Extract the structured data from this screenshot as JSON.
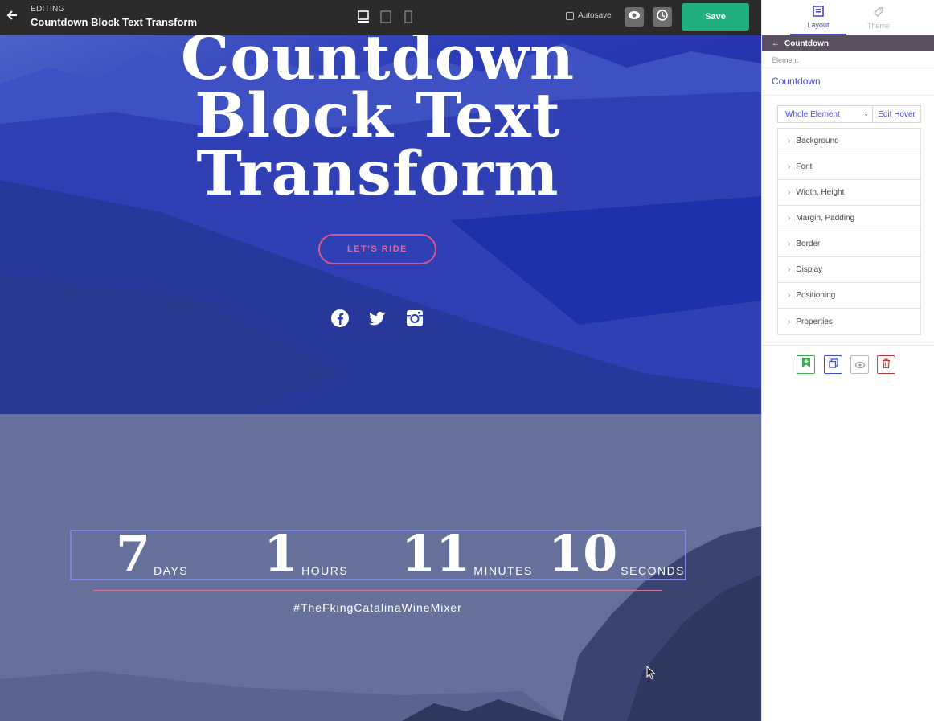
{
  "topbar": {
    "editing_label": "EDITING",
    "title": "Countdown Block Text Transform",
    "autosave_label": "Autosave",
    "save_label": "Save"
  },
  "hero": {
    "title_lines": [
      "Countdown",
      "Block Text",
      "Transform"
    ],
    "button_label": "LET'S RIDE",
    "social": [
      "facebook-icon",
      "twitter-icon",
      "instagram-icon"
    ]
  },
  "countdown": {
    "units": [
      {
        "value": "7",
        "label": "DAYS"
      },
      {
        "value": "1",
        "label": "HOURS"
      },
      {
        "value": "11",
        "label": "MINUTES"
      },
      {
        "value": "10",
        "label": "SECONDS"
      }
    ],
    "hashtag": "#TheFkingCatalinaWineMixer"
  },
  "panel": {
    "tabs": [
      {
        "label": "Layout",
        "icon": "layout-icon",
        "active": true
      },
      {
        "label": "Theme",
        "icon": "theme-icon",
        "active": false
      }
    ],
    "breadcrumb": "Countdown",
    "section_label": "Element",
    "element_name": "Countdown",
    "selector_value": "Whole Element",
    "edit_hover_label": "Edit Hover",
    "accordion": [
      "Background",
      "Font",
      "Width, Height",
      "Margin, Padding",
      "Border",
      "Display",
      "Positioning",
      "Properties"
    ],
    "action_icons": [
      "bookmark-add-icon",
      "duplicate-icon",
      "visibility-icon",
      "delete-icon"
    ]
  },
  "colors": {
    "accent": "#4a4ad0",
    "save": "#1fb07e",
    "pink": "#d9558f",
    "hero_tint": "#2a3bb5",
    "lower_bg": "#67729c",
    "breadcrumb_bg": "#5a5060"
  }
}
